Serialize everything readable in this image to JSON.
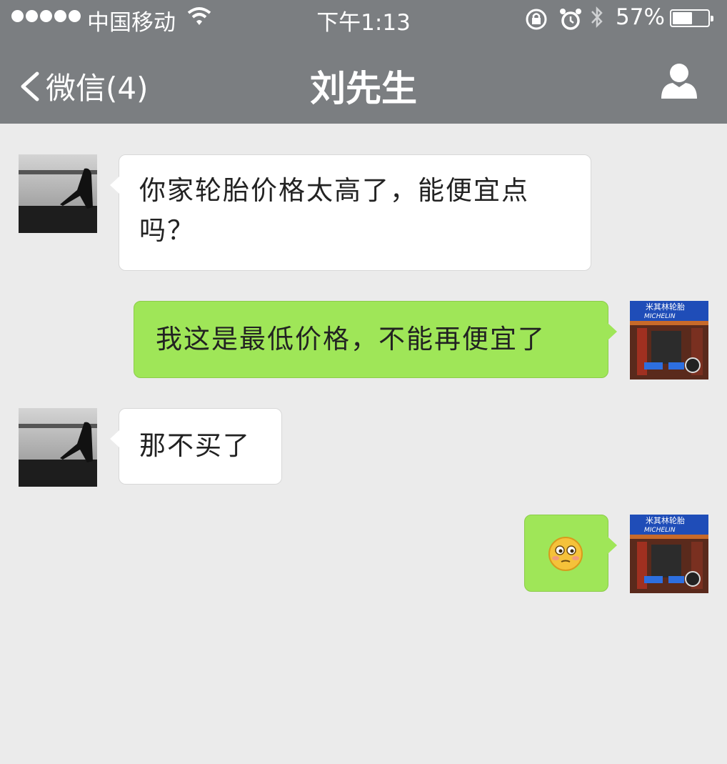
{
  "status_bar": {
    "carrier": "中国移动",
    "time": "下午1:13",
    "battery": "57%",
    "battery_level": 0.57
  },
  "nav": {
    "back_label": "微信(4)",
    "title": "刘先生"
  },
  "messages": [
    {
      "side": "in",
      "text": "你家轮胎价格太高了，能便宜点吗？"
    },
    {
      "side": "out",
      "text": "我这是最低价格，不能再便宜了"
    },
    {
      "side": "in",
      "text": "那不买了"
    },
    {
      "side": "out",
      "sticker": "awkward-smile-emoji"
    }
  ],
  "shop_avatar": {
    "sign_text": "米其林轮胎",
    "brand": "MICHELIN"
  },
  "colors": {
    "nav_bg": "#7b7e81",
    "chat_bg": "#ebebeb",
    "bubble_in": "#ffffff",
    "bubble_out": "#9fe658"
  }
}
